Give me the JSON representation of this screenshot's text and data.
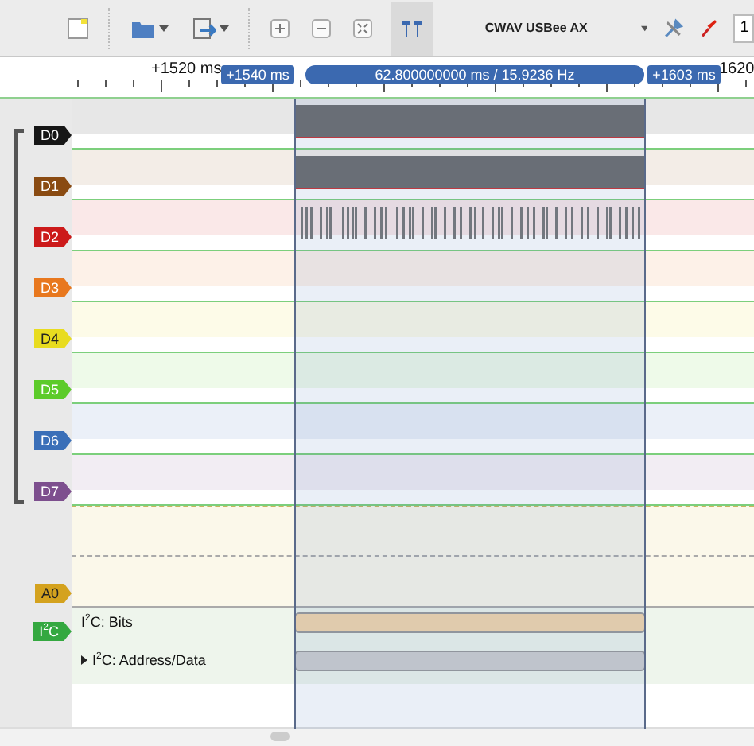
{
  "toolbar": {
    "device": "CWAV USBee AX",
    "markers_on": true,
    "sample_field": "1"
  },
  "ruler": {
    "labels": [
      "+1520 ms",
      "1620"
    ],
    "markers": [
      {
        "kind": "start",
        "text": "+1540 ms"
      },
      {
        "kind": "span",
        "text": "62.800000000 ms / 15.9236 Hz"
      },
      {
        "kind": "end",
        "text": "+1603 ms"
      }
    ]
  },
  "channels": [
    {
      "label": "D0",
      "color": "#161616",
      "kind": "dense"
    },
    {
      "label": "D1",
      "color": "#8a4b12",
      "kind": "dense"
    },
    {
      "label": "D2",
      "color": "#cc1a1a",
      "kind": "bursts"
    },
    {
      "label": "D3",
      "color": "#e8781e",
      "kind": "flat"
    },
    {
      "label": "D4",
      "color": "#e8dc20",
      "kind": "flat"
    },
    {
      "label": "D5",
      "color": "#5ccb2a",
      "kind": "flat"
    },
    {
      "label": "D6",
      "color": "#3a6fb8",
      "kind": "flat"
    },
    {
      "label": "D7",
      "color": "#7d4f8e",
      "kind": "flat"
    }
  ],
  "analog": {
    "label": "A0",
    "color": "#d4a21e"
  },
  "protocol": {
    "label": "I$^{2}$C",
    "color": "#34a840",
    "rows": [
      {
        "kind": "bits",
        "label": "I$^{2}$C: Bits"
      },
      {
        "kind": "data",
        "label": "I$^{2}$C: Address/Data",
        "expanded": false
      }
    ]
  }
}
